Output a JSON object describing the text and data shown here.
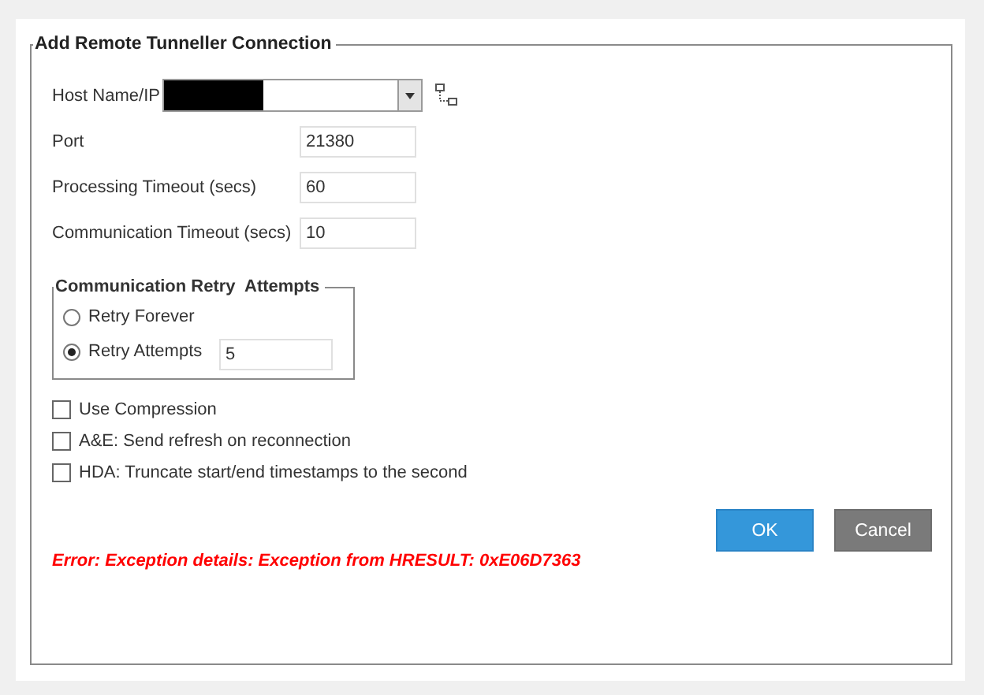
{
  "group": {
    "title": "Add Remote Tunneller Connection"
  },
  "host": {
    "label": "Host Name/IP"
  },
  "fields": [
    {
      "label": "Port",
      "value": "21380"
    },
    {
      "label": "Processing Timeout (secs)",
      "value": "60"
    },
    {
      "label": "Communication Timeout (secs)",
      "value": "10"
    }
  ],
  "retry": {
    "title": "Communication Retry  Attempts",
    "options": [
      {
        "label": "Retry Forever",
        "selected": false
      },
      {
        "label": "Retry Attempts",
        "selected": true
      }
    ],
    "attempts": "5"
  },
  "options": [
    {
      "label": "Use Compression",
      "checked": false
    },
    {
      "label": "A&E: Send refresh on reconnection",
      "checked": false
    },
    {
      "label": "HDA: Truncate start/end timestamps to the second",
      "checked": false
    }
  ],
  "buttons": [
    {
      "label": "OK",
      "kind": "primary"
    },
    {
      "label": "Cancel",
      "kind": "secondary"
    }
  ],
  "error": "Error: Exception details: Exception from HRESULT: 0xE06D7363"
}
